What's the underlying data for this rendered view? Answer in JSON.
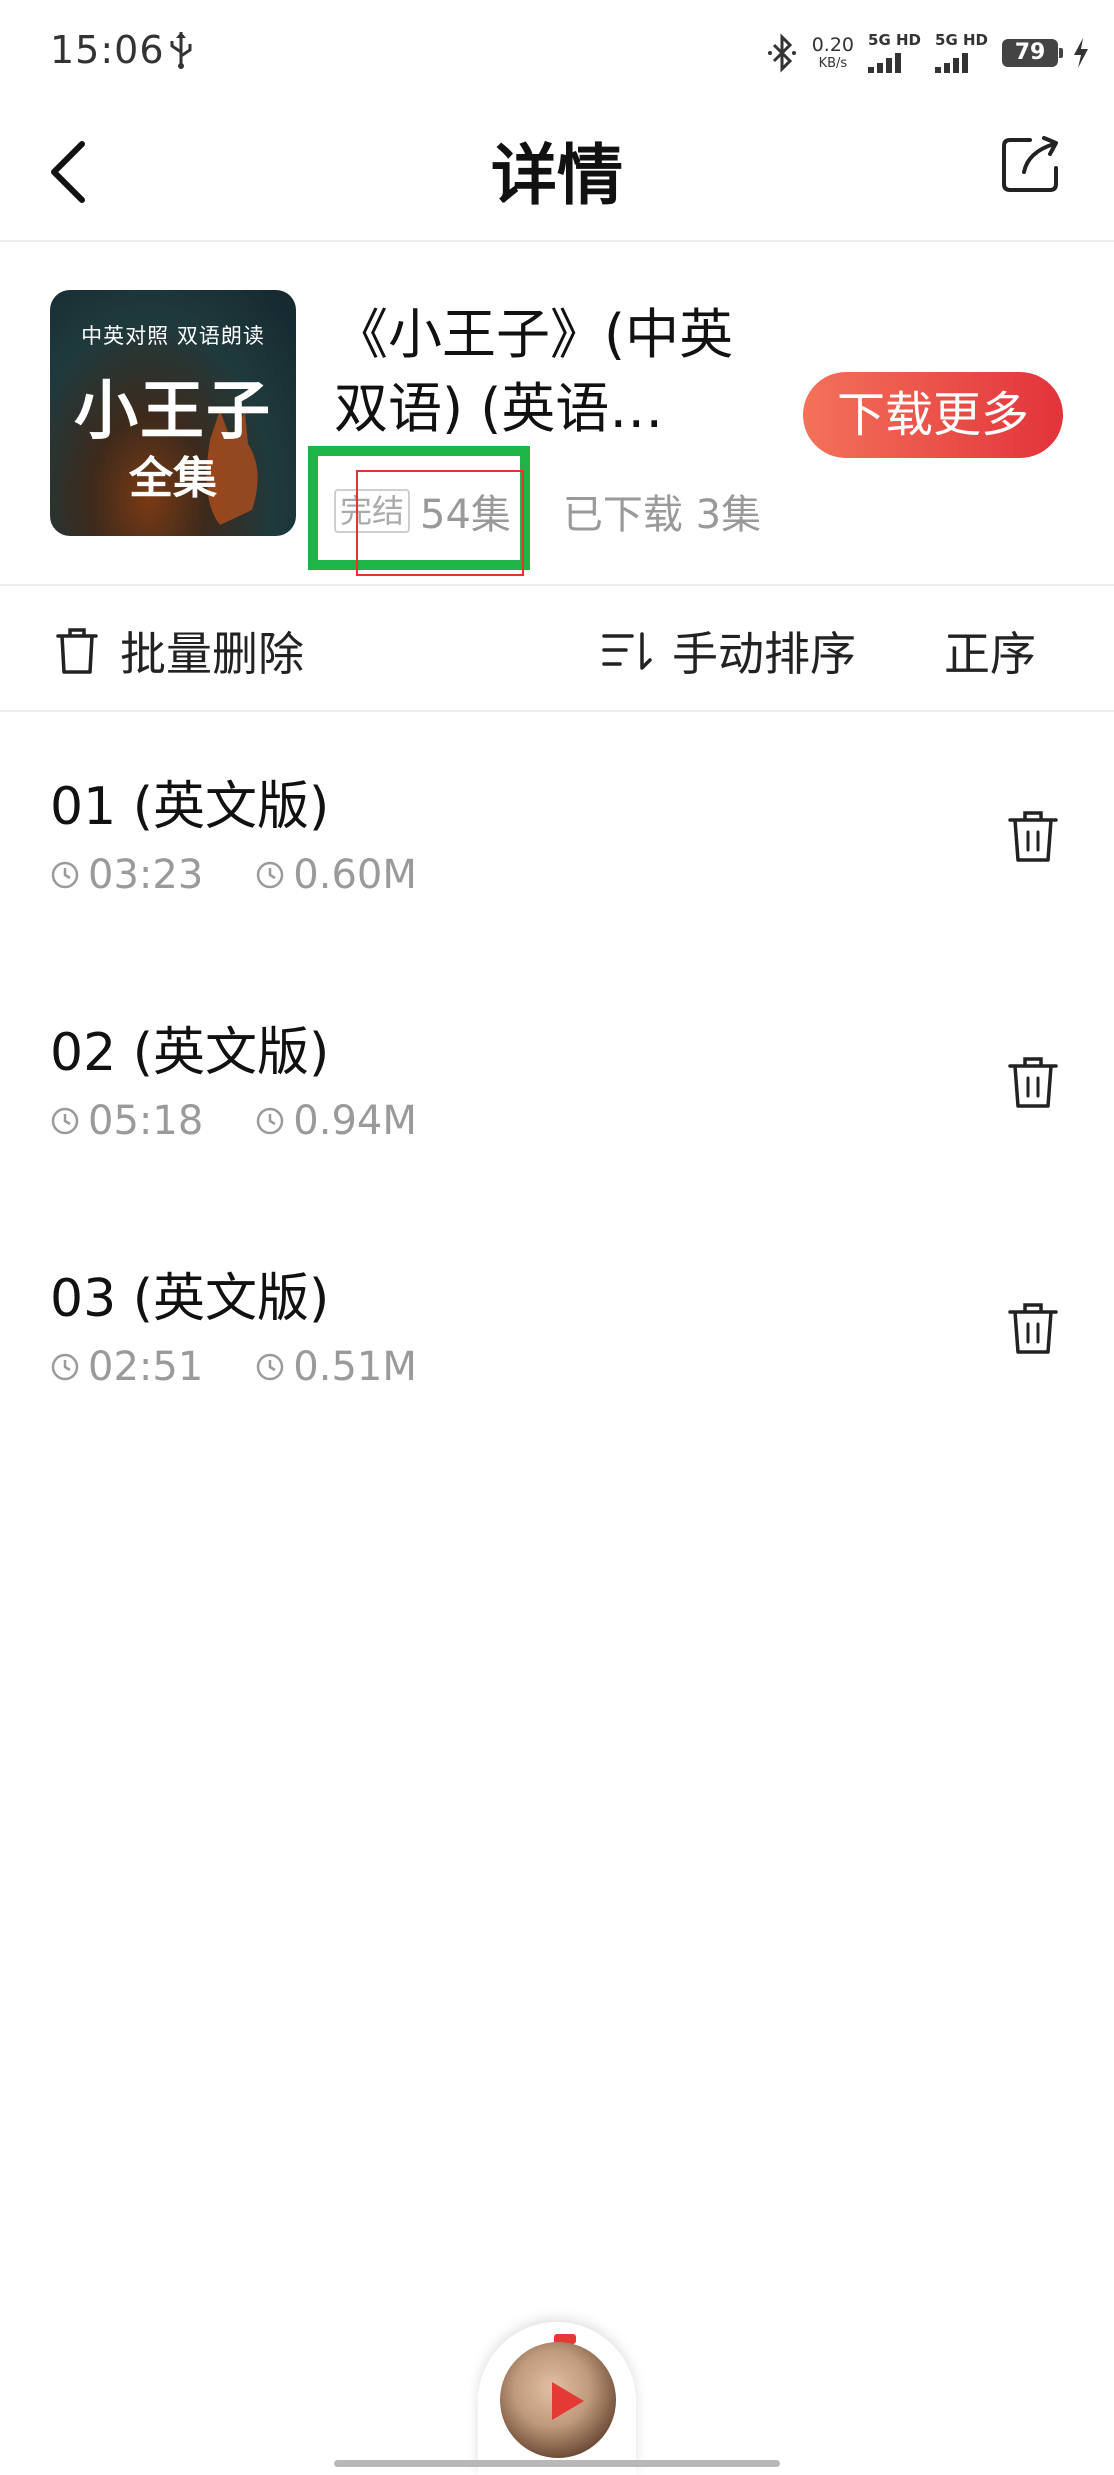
{
  "status_bar": {
    "time": "15:06",
    "net_speed": "0.20",
    "net_unit": "KB/s",
    "sim1_label": "5G HD",
    "sim2_label": "5G HD",
    "battery": "79"
  },
  "header": {
    "title": "详情"
  },
  "album": {
    "cover_top_text": "中英对照 双语朗读",
    "cover_title": "小王子",
    "cover_subtitle": "全集",
    "title": "《小王子》(中英双语) (英语…",
    "status_tag": "完结",
    "episodes_count": "54集",
    "downloaded_count": "已下载 3集",
    "download_more_label": "下载更多"
  },
  "toolbar": {
    "batch_delete_label": "批量删除",
    "manual_sort_label": "手动排序",
    "order_label": "正序"
  },
  "episodes": [
    {
      "title": "01 (英文版)",
      "duration": "03:23",
      "size": "0.60M"
    },
    {
      "title": "02 (英文版)",
      "duration": "05:18",
      "size": "0.94M"
    },
    {
      "title": "03 (英文版)",
      "duration": "02:51",
      "size": "0.51M"
    }
  ],
  "colors": {
    "accent_start": "#f3725a",
    "accent_end": "#e2333a",
    "annotation_green": "#1fb448",
    "annotation_red": "#e8322e"
  },
  "icons": [
    "usb-icon",
    "bluetooth-icon",
    "bolt-icon",
    "back-icon",
    "share-icon",
    "trash-icon",
    "sort-icon",
    "clock-icon",
    "play-icon"
  ]
}
